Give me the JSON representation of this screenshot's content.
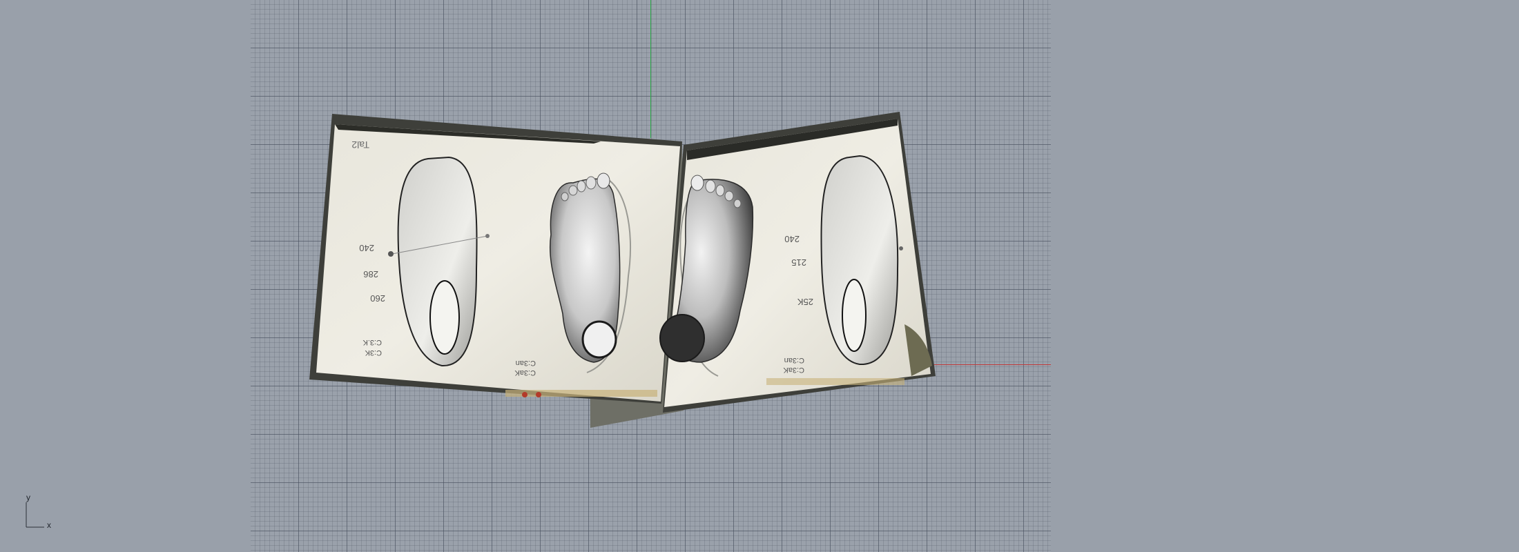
{
  "viewport": {
    "colors": {
      "background": "#99a0aa",
      "grid_minor": "#7d8592",
      "grid_major": "#5f6775",
      "x_axis": "#c03a3a",
      "y_axis": "#2ea84a"
    }
  },
  "axis_gizmo": {
    "x_label": "x",
    "y_label": "y"
  },
  "paper_left": {
    "corner_note": "Tal2",
    "measurements": [
      "240",
      "286",
      "260",
      "C:3.K",
      "C:3K"
    ],
    "lower_notes": [
      "C:3an",
      "C:3aK"
    ]
  },
  "paper_right": {
    "measurements": [
      "240",
      "215",
      "25K"
    ],
    "lower_notes": [
      "C:3an",
      "C:3aK"
    ]
  },
  "icons": [
    "left-foot-scan-icon",
    "right-foot-scan-icon",
    "left-insole-outline-icon",
    "right-insole-outline-icon"
  ]
}
